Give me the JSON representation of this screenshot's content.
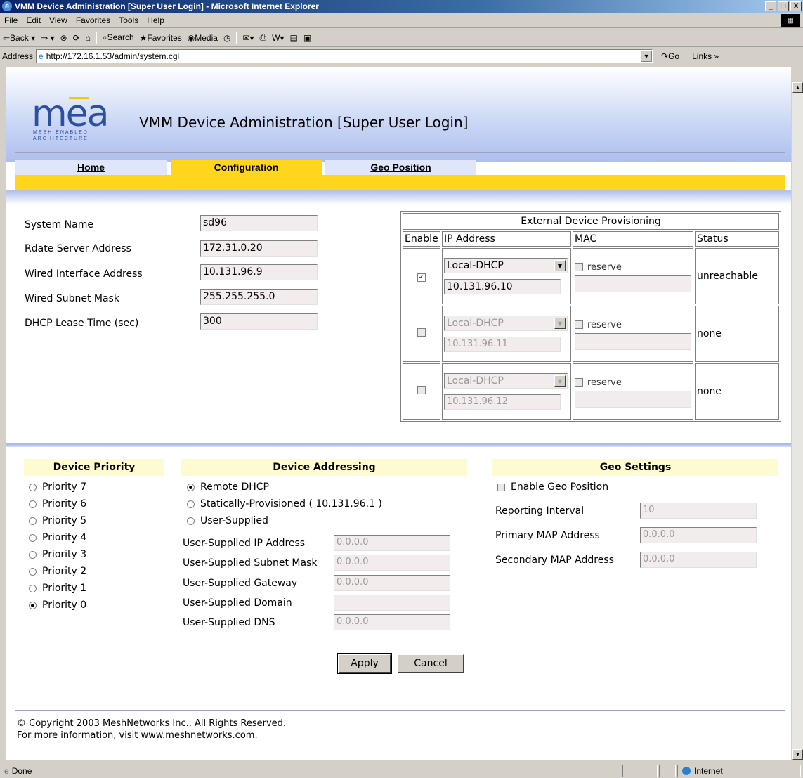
{
  "window": {
    "title": "VMM Device Administration [Super User Login] - Microsoft Internet Explorer",
    "controls": [
      "_",
      "□",
      "X"
    ]
  },
  "menu": [
    "File",
    "Edit",
    "View",
    "Favorites",
    "Tools",
    "Help"
  ],
  "toolbar": {
    "back": "⇐Back ▾",
    "forward": "⇒ ▾",
    "search": "Search",
    "favorites": "Favorites",
    "media": "Media"
  },
  "address": {
    "label": "Address",
    "url": "http://172.16.1.53/admin/system.cgi",
    "go": "Go",
    "links": "Links »"
  },
  "page": {
    "logo": {
      "word": "mea",
      "sub1": "MESH ENABLED",
      "sub2": "ARCHITECTURE"
    },
    "title": "VMM Device Administration [Super User Login]",
    "tabs": [
      "Home",
      "Configuration",
      "Geo Position"
    ],
    "active_tab": "Configuration",
    "system": [
      {
        "label": "System Name",
        "value": "sd96"
      },
      {
        "label": "Rdate Server Address",
        "value": "172.31.0.20"
      },
      {
        "label": "Wired Interface Address",
        "value": "10.131.96.9"
      },
      {
        "label": "Wired Subnet Mask",
        "value": "255.255.255.0"
      },
      {
        "label": "DHCP Lease Time (sec)",
        "value": "300"
      }
    ],
    "provisioning": {
      "title": "External Device Provisioning",
      "headers": [
        "Enable",
        "IP Address",
        "MAC",
        "Status"
      ],
      "reserve_label": "reserve",
      "rows": [
        {
          "enabled": true,
          "mode": "Local-DHCP",
          "ip": "10.131.96.10",
          "status": "unreachable"
        },
        {
          "enabled": false,
          "mode": "Local-DHCP",
          "ip": "10.131.96.11",
          "status": "none"
        },
        {
          "enabled": false,
          "mode": "Local-DHCP",
          "ip": "10.131.96.12",
          "status": "none"
        }
      ]
    },
    "priority": {
      "title": "Device Priority",
      "options": [
        "Priority 7",
        "Priority 6",
        "Priority 5",
        "Priority 4",
        "Priority 3",
        "Priority 2",
        "Priority 1",
        "Priority 0"
      ],
      "selected": "Priority 0"
    },
    "addressing": {
      "title": "Device Addressing",
      "options": [
        "Remote DHCP",
        "Statically-Provisioned ( 10.131.96.1 )",
        "User-Supplied"
      ],
      "selected": "Remote DHCP",
      "fields": [
        {
          "label": "User-Supplied IP Address",
          "value": "0.0.0.0"
        },
        {
          "label": "User-Supplied Subnet Mask",
          "value": "0.0.0.0"
        },
        {
          "label": "User-Supplied Gateway",
          "value": "0.0.0.0"
        },
        {
          "label": "User-Supplied Domain",
          "value": ""
        },
        {
          "label": "User-Supplied DNS",
          "value": "0.0.0.0"
        }
      ]
    },
    "geo": {
      "title": "Geo Settings",
      "enable_label": "Enable Geo Position",
      "fields": [
        {
          "label": "Reporting Interval",
          "value": "10"
        },
        {
          "label": "Primary MAP Address",
          "value": "0.0.0.0"
        },
        {
          "label": "Secondary MAP Address",
          "value": "0.0.0.0"
        }
      ]
    },
    "buttons": {
      "apply": "Apply",
      "cancel": "Cancel"
    },
    "footer": {
      "copyright": "© Copyright 2003 MeshNetworks Inc., All Rights Reserved.",
      "info_prefix": "For more information, visit ",
      "link": "www.meshnetworks.com",
      "info_suffix": "."
    }
  },
  "status": {
    "left": "Done",
    "zone": "Internet"
  }
}
